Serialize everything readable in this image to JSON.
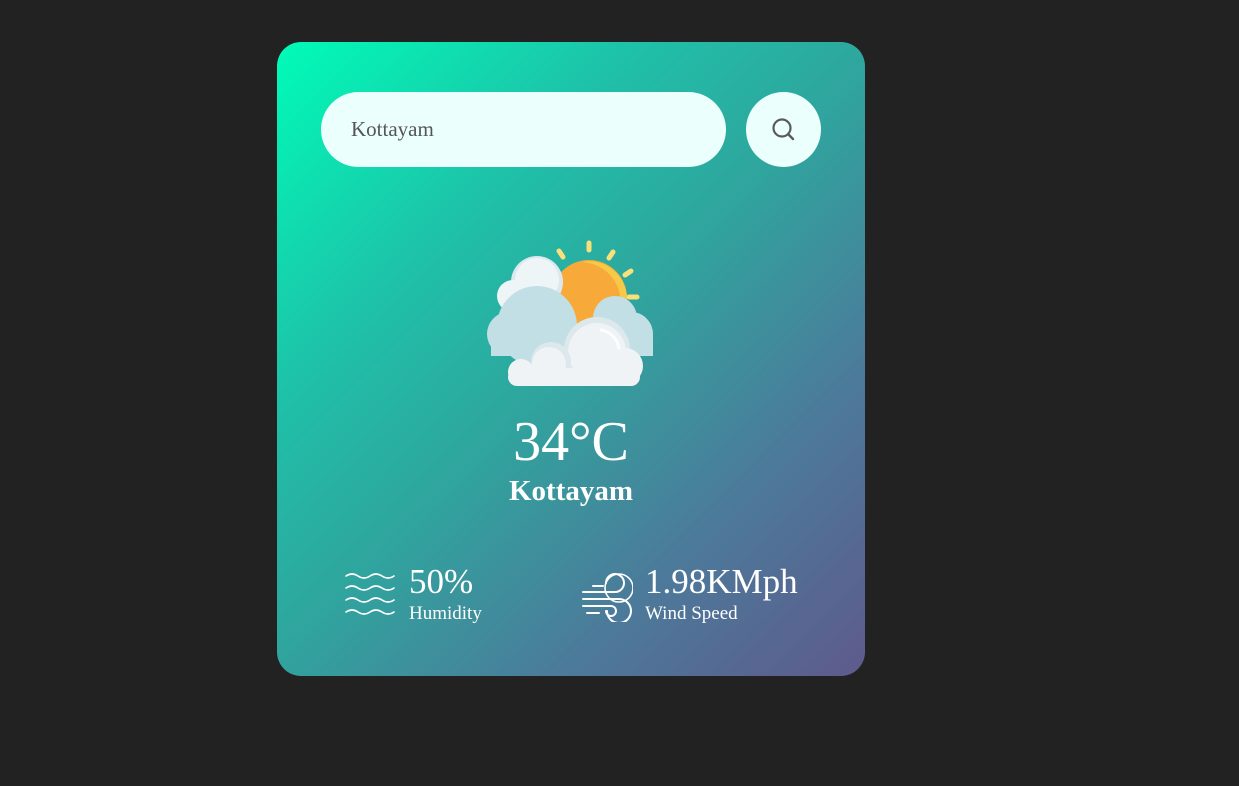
{
  "search": {
    "value": "Kottayam",
    "button_icon": "search-icon"
  },
  "weather": {
    "icon": "partly-cloudy-sun-icon",
    "temperature": "34°C",
    "city": "Kottayam"
  },
  "details": {
    "humidity": {
      "icon": "humidity-icon",
      "value": "50%",
      "label": "Humidity"
    },
    "wind": {
      "icon": "wind-icon",
      "value": "1.98KMph",
      "label": "Wind Speed"
    }
  },
  "colors": {
    "page_background": "#222222",
    "card_gradient_start": "#00fcb8",
    "card_gradient_end": "#5e5a8c",
    "input_background": "#ebfffc",
    "text": "#ffffff"
  }
}
